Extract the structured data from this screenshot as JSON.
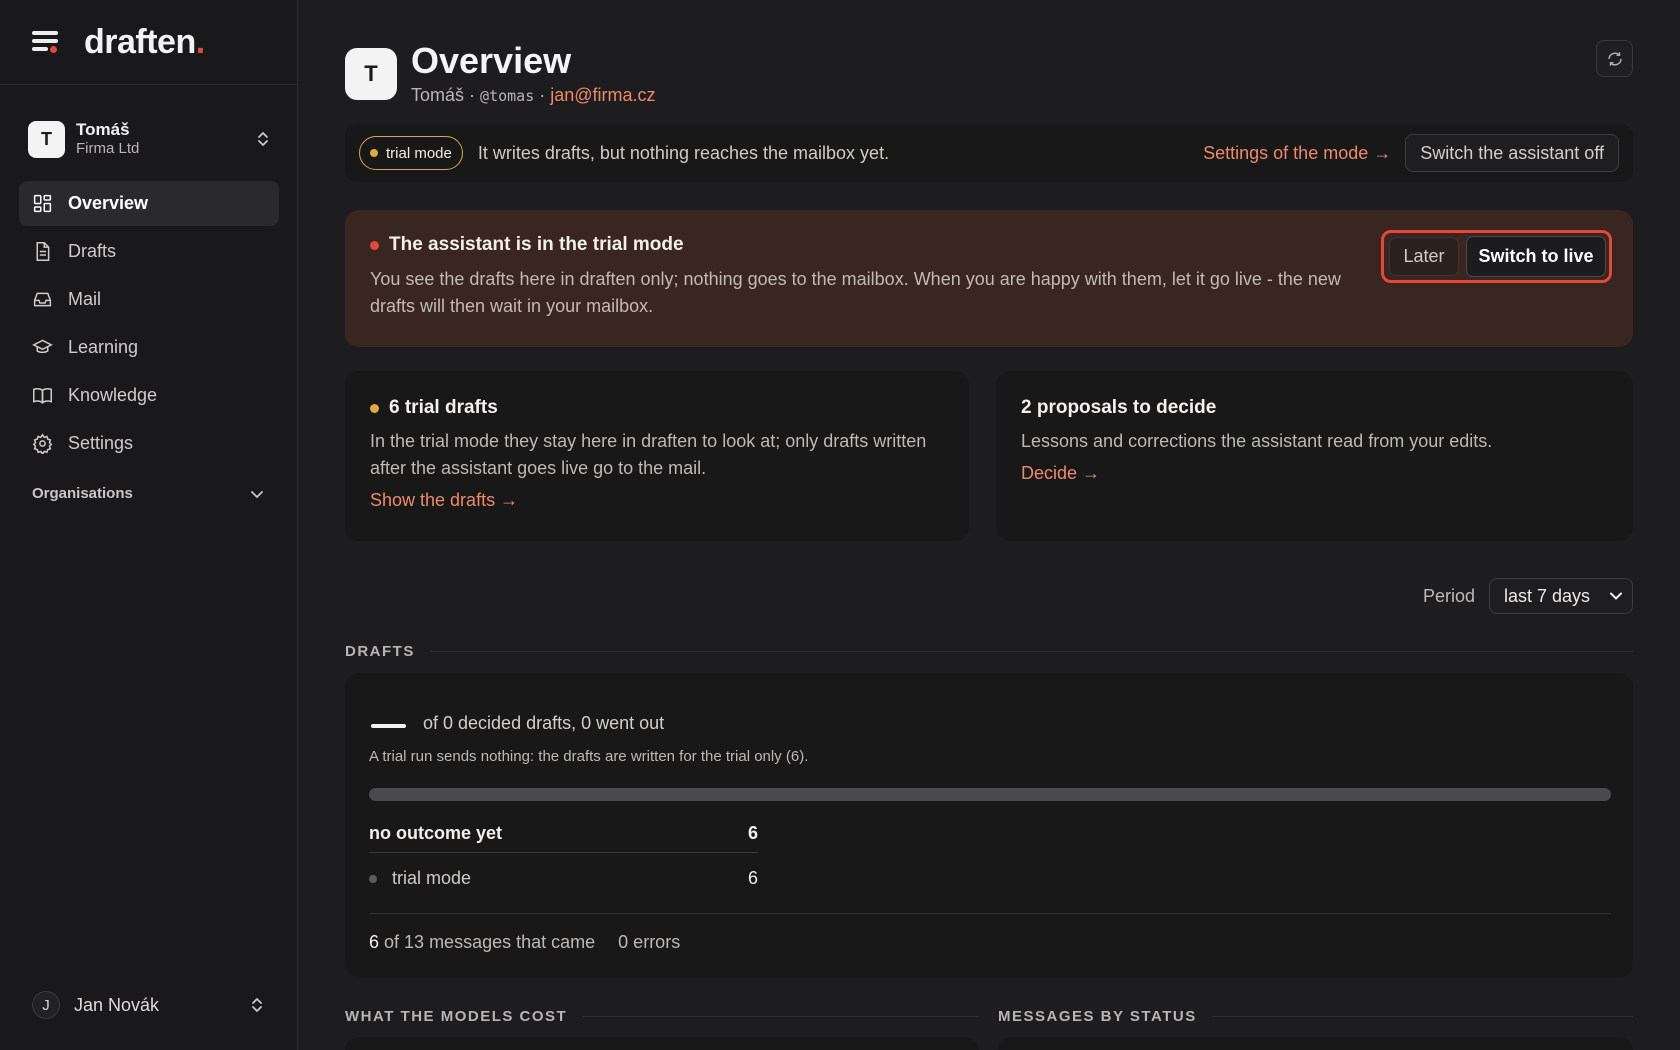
{
  "brand": {
    "name": "draften",
    "dot": "."
  },
  "account": {
    "initial": "T",
    "name": "Tomáš",
    "org": "Firma Ltd"
  },
  "nav": [
    {
      "label": "Overview",
      "icon": "dashboard-icon",
      "active": true
    },
    {
      "label": "Drafts",
      "icon": "document-icon",
      "active": false
    },
    {
      "label": "Mail",
      "icon": "inbox-icon",
      "active": false
    },
    {
      "label": "Learning",
      "icon": "graduation-cap-icon",
      "active": false
    },
    {
      "label": "Knowledge",
      "icon": "book-icon",
      "active": false
    },
    {
      "label": "Settings",
      "icon": "gear-icon",
      "active": false
    }
  ],
  "organisations_label": "Organisations",
  "user": {
    "initial": "J",
    "name": "Jan Novák"
  },
  "header": {
    "initial": "T",
    "title": "Overview",
    "name": "Tomáš",
    "sep": "·",
    "handle": "@tomas",
    "email": "jan@firma.cz"
  },
  "modebar": {
    "pill": "trial mode",
    "text": "It writes drafts, but nothing reaches the mailbox yet.",
    "settings_link": "Settings of the mode →",
    "switch_off": "Switch the assistant off"
  },
  "banner": {
    "title": "The assistant is in the trial mode",
    "body": "You see the drafts here in draften only; nothing goes to the mailbox. When you are happy with them, let it go live - the new drafts will then wait in your mailbox.",
    "later": "Later",
    "live": "Switch to live"
  },
  "cards": {
    "trial": {
      "title": "6 trial drafts",
      "body": "In the trial mode they stay here in draften to look at; only drafts written after the assistant goes live go to the mail.",
      "link": "Show the drafts →"
    },
    "proposals": {
      "title": "2 proposals to decide",
      "body": "Lessons and corrections the assistant read from your edits.",
      "link": "Decide →"
    }
  },
  "period": {
    "label": "Period",
    "value": "last 7 days"
  },
  "sections": {
    "drafts": "DRAFTS",
    "cost": "WHAT THE MODELS COST",
    "status": "MESSAGES BY STATUS"
  },
  "drafts": {
    "stat": "of 0 decided drafts, 0 went out",
    "note": "A trial run sends nothing: the drafts are written for the trial only (6).",
    "progress": 0,
    "row_main_label": "no outcome yet",
    "row_main_value": "6",
    "row_sub_label": "trial mode",
    "row_sub_value": "6",
    "footer_count": "6",
    "footer_text": "of 13 messages that came",
    "footer_errors": "0 errors"
  },
  "colors": {
    "accent": "#e4473b",
    "link": "#ee8a6a",
    "warning": "#e3a743",
    "banner_bg": "#3a2620"
  }
}
